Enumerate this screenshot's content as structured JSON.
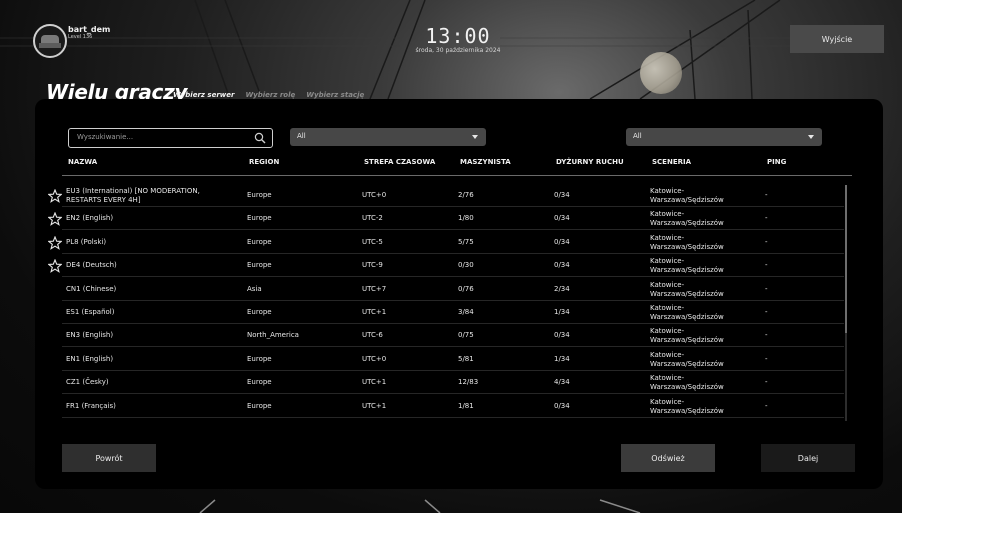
{
  "user": {
    "name": "bart_dem",
    "level": "Level 136"
  },
  "clock": {
    "time": "13:00",
    "date": "środa, 30 października 2024"
  },
  "exit_label": "Wyjście",
  "page_title": "Wielu graczy",
  "steps": [
    "Wybierz serwer",
    "Wybierz rolę",
    "Wybierz stację"
  ],
  "search": {
    "placeholder": "Wyszukiwanie..."
  },
  "filters": {
    "region": "All",
    "scenery": "All"
  },
  "columns": [
    "NAZWA",
    "REGION",
    "STREFA CZASOWA",
    "MASZYNISTA",
    "DYŻURNY RUCHU",
    "SCENERIA",
    "PING"
  ],
  "servers": [
    {
      "name_l1": "EU3 (International) [NO MODERATION,",
      "name_l2": "RESTARTS EVERY 4H]",
      "region": "Europe",
      "tz": "UTC+0",
      "driver": "2/76",
      "dispatcher": "0/34",
      "scen_l1": "Katowice-",
      "scen_l2": "Warszawa/Sędziszów",
      "ping": "-",
      "star": true
    },
    {
      "name_l1": "EN2 (English)",
      "name_l2": "",
      "region": "Europe",
      "tz": "UTC-2",
      "driver": "1/80",
      "dispatcher": "0/34",
      "scen_l1": "Katowice-",
      "scen_l2": "Warszawa/Sędziszów",
      "ping": "-",
      "star": true
    },
    {
      "name_l1": "PL8 (Polski)",
      "name_l2": "",
      "region": "Europe",
      "tz": "UTC-5",
      "driver": "5/75",
      "dispatcher": "0/34",
      "scen_l1": "Katowice-",
      "scen_l2": "Warszawa/Sędziszów",
      "ping": "-",
      "star": true
    },
    {
      "name_l1": "DE4 (Deutsch)",
      "name_l2": "",
      "region": "Europe",
      "tz": "UTC-9",
      "driver": "0/30",
      "dispatcher": "0/34",
      "scen_l1": "Katowice-",
      "scen_l2": "Warszawa/Sędziszów",
      "ping": "-",
      "star": true
    },
    {
      "name_l1": "CN1 (Chinese)",
      "name_l2": "",
      "region": "Asia",
      "tz": "UTC+7",
      "driver": "0/76",
      "dispatcher": "2/34",
      "scen_l1": "Katowice-",
      "scen_l2": "Warszawa/Sędziszów",
      "ping": "-",
      "star": false
    },
    {
      "name_l1": "ES1 (Español)",
      "name_l2": "",
      "region": "Europe",
      "tz": "UTC+1",
      "driver": "3/84",
      "dispatcher": "1/34",
      "scen_l1": "Katowice-",
      "scen_l2": "Warszawa/Sędziszów",
      "ping": "-",
      "star": false
    },
    {
      "name_l1": "EN3 (English)",
      "name_l2": "",
      "region": "North_America",
      "tz": "UTC-6",
      "driver": "0/75",
      "dispatcher": "0/34",
      "scen_l1": "Katowice-",
      "scen_l2": "Warszawa/Sędziszów",
      "ping": "-",
      "star": false
    },
    {
      "name_l1": "EN1 (English)",
      "name_l2": "",
      "region": "Europe",
      "tz": "UTC+0",
      "driver": "5/81",
      "dispatcher": "1/34",
      "scen_l1": "Katowice-",
      "scen_l2": "Warszawa/Sędziszów",
      "ping": "-",
      "star": false
    },
    {
      "name_l1": "CZ1 (Česky)",
      "name_l2": "",
      "region": "Europe",
      "tz": "UTC+1",
      "driver": "12/83",
      "dispatcher": "4/34",
      "scen_l1": "Katowice-",
      "scen_l2": "Warszawa/Sędziszów",
      "ping": "-",
      "star": false
    },
    {
      "name_l1": "FR1 (Français)",
      "name_l2": "",
      "region": "Europe",
      "tz": "UTC+1",
      "driver": "1/81",
      "dispatcher": "0/34",
      "scen_l1": "Katowice-",
      "scen_l2": "Warszawa/Sędziszów",
      "ping": "-",
      "star": false
    }
  ],
  "buttons": {
    "back": "Powrót",
    "refresh": "Odśwież",
    "next": "Dalej"
  },
  "icons": {
    "search": "search-icon",
    "favorite": "star-outline-icon",
    "dropdown": "chevron-down-icon"
  },
  "colors": {
    "panel": "#000000",
    "button": "#2f2f2f",
    "dropdown": "#474747",
    "text": "#e8e8e8"
  }
}
